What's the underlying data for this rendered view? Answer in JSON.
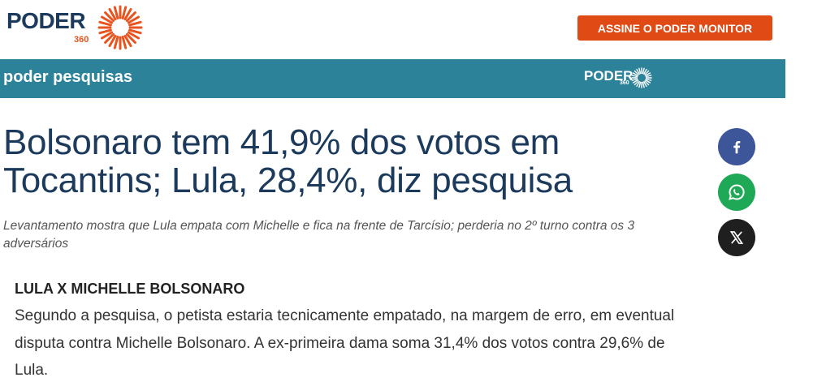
{
  "header": {
    "logo_word": "PODER",
    "logo_number": "360",
    "cta_label": "ASSINE O PODER MONITOR"
  },
  "band": {
    "section_label": "poder pesquisas",
    "mini_logo_word": "PODER",
    "mini_logo_number": "360"
  },
  "article": {
    "headline": "Bolsonaro tem 41,9% dos votos em Tocantins; Lula, 28,4%, diz pesquisa",
    "subtitle": "Levantamento mostra que Lula empata com Michelle e fica na frente de Tarcísio; perderia no 2º turno contra os 3 adversários",
    "section_heading": "LULA X MICHELLE BOLSONARO",
    "paragraph": "Segundo a pesquisa, o petista estaria tecnicamente empatado, na margem de erro, em eventual disputa contra Michelle Bolsonaro. A ex-primeira dama soma 31,4% dos votos contra 29,6% de Lula."
  },
  "share": {
    "facebook_icon": "facebook-icon",
    "whatsapp_icon": "whatsapp-icon",
    "x_icon": "x-icon"
  },
  "colors": {
    "brand_navy": "#1b3a5c",
    "brand_orange": "#e8541f",
    "cta_red": "#e04a15",
    "band_teal": "#2b8299",
    "facebook": "#3d5599",
    "whatsapp": "#1fa855",
    "x": "#1f1f1f"
  }
}
